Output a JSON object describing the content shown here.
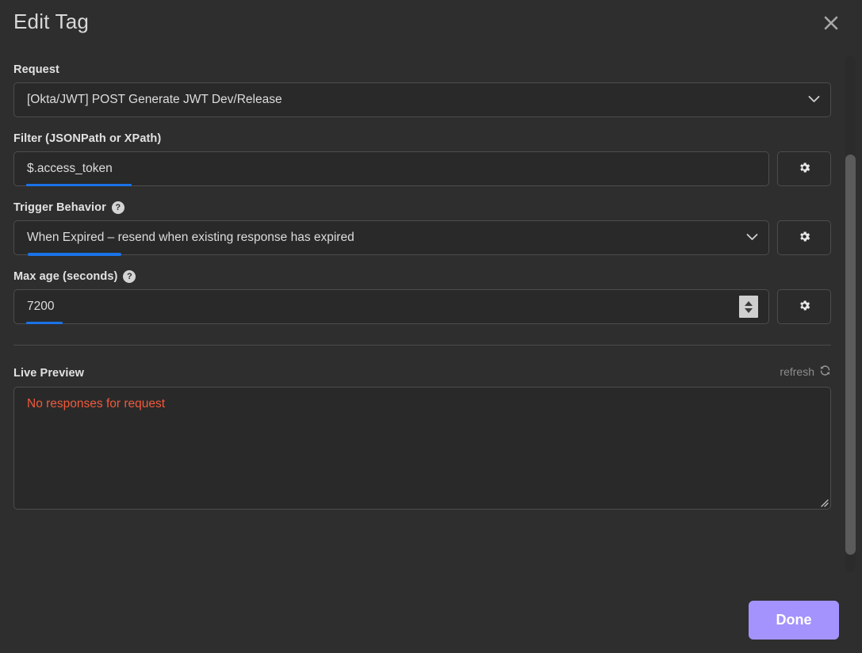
{
  "header": {
    "title": "Edit Tag",
    "close_icon": "close-icon"
  },
  "fields": {
    "request": {
      "label": "Request",
      "value": "[Okta/JWT] POST Generate JWT Dev/Release",
      "chevron_icon": "chevron-down-icon"
    },
    "filter": {
      "label": "Filter (JSONPath or XPath)",
      "value": "$.access_token",
      "placeholder": "$.access_token",
      "gear_icon": "gear-icon"
    },
    "trigger_behavior": {
      "label": "Trigger Behavior",
      "help_icon": "?",
      "value": "When Expired – resend when existing response has expired",
      "chevron_icon": "chevron-down-icon",
      "gear_icon": "gear-icon"
    },
    "max_age": {
      "label": "Max age (seconds)",
      "help_icon": "?",
      "value": "7200",
      "gear_icon": "gear-icon"
    }
  },
  "live_preview": {
    "label": "Live Preview",
    "refresh_label": "refresh",
    "refresh_icon": "refresh-icon",
    "content": "No responses for request"
  },
  "footer": {
    "done_label": "Done"
  },
  "colors": {
    "background": "#2e2e2e",
    "input_background": "#292929",
    "border": "#4d4d4d",
    "accent_done": "#a493fd",
    "error_text": "#f05a3c",
    "spellcheck_underline": "#1a73e8",
    "muted_text": "#8d8d8d"
  }
}
